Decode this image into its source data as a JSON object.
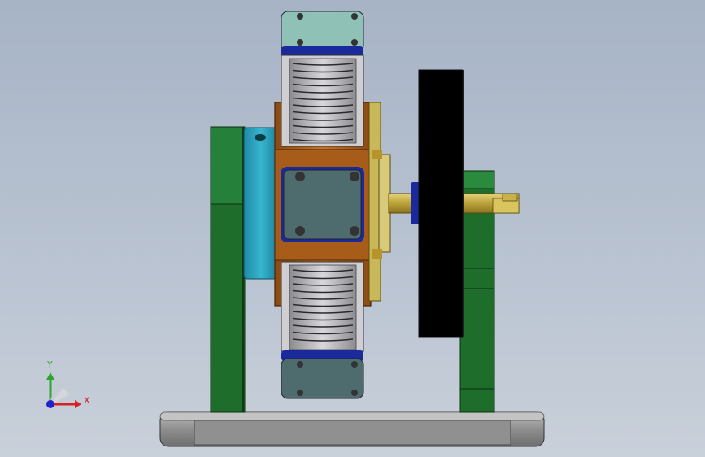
{
  "viewport": {
    "background_top": "#a7b4c6",
    "background_bottom": "#c9d0da",
    "model_parts": [
      "base-plate",
      "left-support-bracket",
      "stator-housing",
      "upper-magnet-module",
      "lower-magnet-module",
      "center-cover-plate",
      "flange-ring",
      "shaft",
      "flywheel-disc",
      "right-bearing-support"
    ],
    "colors": {
      "support_green": "#1d6a2a",
      "housing_orange": "#b0641e",
      "housing_cyan": "#2aa4c0",
      "cover_plate": "#4e6b6e",
      "top_cap": "#8fc1b7",
      "blue_band": "#1a2a9c",
      "coil_gray": "#b9b9bd",
      "flywheel": "#000000",
      "shaft_yellow": "#c8b24a",
      "base_gray": "#8e8e8e"
    }
  },
  "triad": {
    "x_label": "X",
    "y_label": "Y",
    "x_color": "#d22222",
    "y_color": "#2ea52e",
    "z_color": "#2222cc"
  }
}
